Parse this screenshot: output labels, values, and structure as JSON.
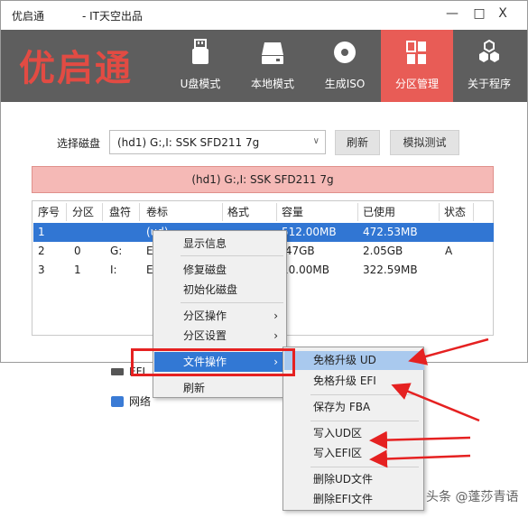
{
  "window": {
    "title": "优启通",
    "publisher": "- IT天空出品",
    "minimize": "—",
    "maximize": "□",
    "close": "X"
  },
  "header": {
    "logo": "优启通",
    "nav": [
      {
        "label": "U盘模式",
        "icon": "usb-drive-icon"
      },
      {
        "label": "本地模式",
        "icon": "hard-disk-icon"
      },
      {
        "label": "生成ISO",
        "icon": "disc-icon"
      },
      {
        "label": "分区管理",
        "icon": "partition-grid-icon",
        "active": true
      },
      {
        "label": "关于程序",
        "icon": "hexagon-cluster-icon"
      }
    ]
  },
  "disk": {
    "select_label": "选择磁盘",
    "selected": "(hd1) G:,I: SSK SFD211 7g",
    "refresh_button": "刷新",
    "simulate_button": "模拟测试",
    "banner": "(hd1) G:,I: SSK SFD211 7g"
  },
  "table": {
    "columns": [
      "序号",
      "分区",
      "盘符",
      "卷标",
      "格式",
      "容量",
      "已使用",
      "状态"
    ],
    "rows": [
      [
        "1",
        "",
        "",
        "(ud)",
        "",
        "512.00MB",
        "472.53MB",
        ""
      ],
      [
        "2",
        "0",
        "G:",
        "E",
        "",
        ".47GB",
        "2.05GB",
        "A"
      ],
      [
        "3",
        "1",
        "I:",
        "E",
        "",
        "10.00MB",
        "322.59MB",
        ""
      ]
    ]
  },
  "context_menu": {
    "items": [
      "显示信息",
      "修复磁盘",
      "初始化磁盘",
      "分区操作",
      "分区设置",
      "文件操作",
      "刷新"
    ]
  },
  "submenu": {
    "items": [
      "免格升级 UD",
      "免格升级 EFI",
      "保存为 FBA",
      "写入UD区",
      "写入EFI区",
      "删除UD文件",
      "删除EFI文件"
    ]
  },
  "background": {
    "efi": "EFI",
    "network": "网络"
  },
  "watermark": "头条 @蓬莎青语",
  "colors": {
    "accent_red": "#e85c56",
    "header_gray": "#5e5e5e",
    "selection_blue": "#3176d3",
    "annotation_red": "#e52121"
  }
}
